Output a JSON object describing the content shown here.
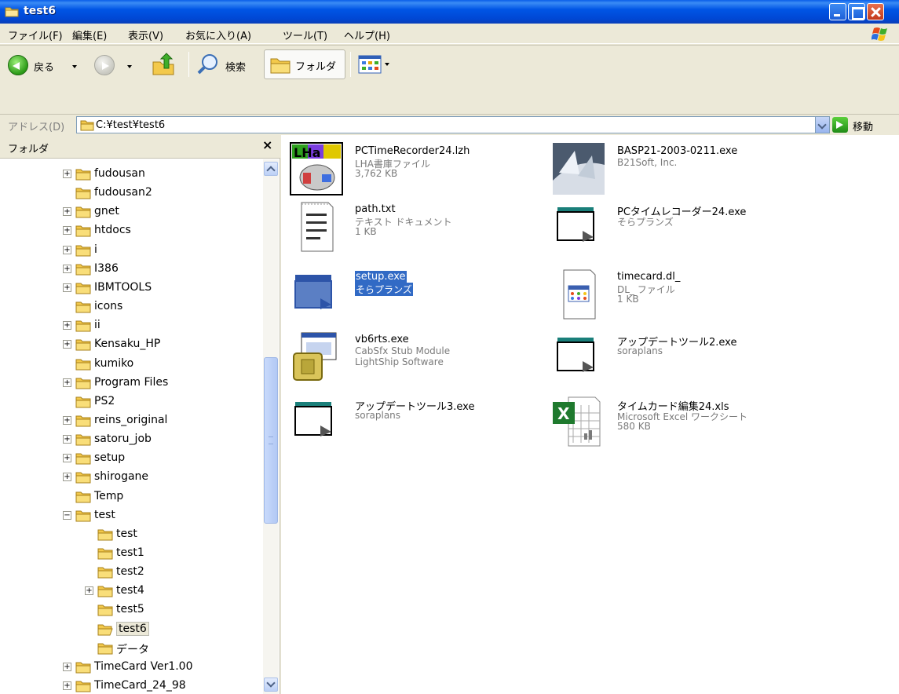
{
  "window": {
    "title": "test6",
    "controls": [
      "minimize",
      "maximize",
      "close"
    ]
  },
  "menubar": {
    "items": [
      "ファイル(F)",
      "編集(E)",
      "表示(V)",
      "お気に入り(A)",
      "ツール(T)",
      "ヘルプ(H)"
    ]
  },
  "toolbar": {
    "back_label": "戻る",
    "search_label": "検索",
    "folders_label": "フォルダ"
  },
  "address": {
    "label": "アドレス(D)",
    "value": "C:¥test¥test6",
    "go_label": "移動"
  },
  "folders_pane": {
    "title": "フォルダ",
    "close": "×",
    "items": [
      {
        "label": "fudousan",
        "expander": "+",
        "indent": 0
      },
      {
        "label": "fudousan2",
        "expander": "",
        "indent": 0
      },
      {
        "label": "gnet",
        "expander": "+",
        "indent": 0
      },
      {
        "label": "htdocs",
        "expander": "+",
        "indent": 0
      },
      {
        "label": "i",
        "expander": "+",
        "indent": 0
      },
      {
        "label": "I386",
        "expander": "+",
        "indent": 0
      },
      {
        "label": "IBMTOOLS",
        "expander": "+",
        "indent": 0
      },
      {
        "label": "icons",
        "expander": "",
        "indent": 0
      },
      {
        "label": "ii",
        "expander": "+",
        "indent": 0
      },
      {
        "label": "Kensaku_HP",
        "expander": "+",
        "indent": 0
      },
      {
        "label": "kumiko",
        "expander": "",
        "indent": 0
      },
      {
        "label": "Program Files",
        "expander": "+",
        "indent": 0
      },
      {
        "label": "PS2",
        "expander": "",
        "indent": 0
      },
      {
        "label": "reins_original",
        "expander": "+",
        "indent": 0
      },
      {
        "label": "satoru_job",
        "expander": "+",
        "indent": 0
      },
      {
        "label": "setup",
        "expander": "+",
        "indent": 0
      },
      {
        "label": "shirogane",
        "expander": "+",
        "indent": 0
      },
      {
        "label": "Temp",
        "expander": "",
        "indent": 0
      },
      {
        "label": "test",
        "expander": "−",
        "indent": 0
      },
      {
        "label": "test",
        "expander": "",
        "indent": 1
      },
      {
        "label": "test1",
        "expander": "",
        "indent": 1
      },
      {
        "label": "test2",
        "expander": "",
        "indent": 1
      },
      {
        "label": "test4",
        "expander": "+",
        "indent": 1
      },
      {
        "label": "test5",
        "expander": "",
        "indent": 1
      },
      {
        "label": "test6",
        "expander": "",
        "indent": 1,
        "selected": true,
        "open": true
      },
      {
        "label": "データ",
        "expander": "",
        "indent": 1
      },
      {
        "label": "TimeCard Ver1.00",
        "expander": "+",
        "indent": 0
      },
      {
        "label": "TimeCard_24_98",
        "expander": "+",
        "indent": 0
      }
    ]
  },
  "files": [
    {
      "name": "PCTimeRecorder24.lzh",
      "type": "LHA書庫ファイル",
      "size": "3,762 KB",
      "icon": "lha-archive-icon"
    },
    {
      "name": "BASP21-2003-0211.exe",
      "type": "B21Soft, Inc.",
      "size": "",
      "icon": "basp-installer-icon"
    },
    {
      "name": "path.txt",
      "type": "テキスト ドキュメント",
      "size": "1 KB",
      "icon": "text-document-icon"
    },
    {
      "name": "PCタイムレコーダー24.exe",
      "type": "そらプランズ",
      "size": "",
      "icon": "application-window-icon"
    },
    {
      "name": "setup.exe",
      "type": "そらプランズ",
      "size": "",
      "icon": "setup-window-icon",
      "selected": true
    },
    {
      "name": "timecard.dl_",
      "type": "DL_ ファイル",
      "size": "1 KB",
      "icon": "dll-file-icon"
    },
    {
      "name": "vb6rts.exe",
      "type": "CabSfx Stub Module",
      "size": "LightShip Software",
      "icon": "cab-installer-icon"
    },
    {
      "name": "アップデートツール2.exe",
      "type": "soraplans",
      "size": "",
      "icon": "application-window-icon"
    },
    {
      "name": "アップデートツール3.exe",
      "type": "soraplans",
      "size": "",
      "icon": "application-window-icon"
    },
    {
      "name": "タイムカード編集24.xls",
      "type": "Microsoft Excel ワークシート",
      "size": "580 KB",
      "icon": "excel-worksheet-icon"
    }
  ]
}
